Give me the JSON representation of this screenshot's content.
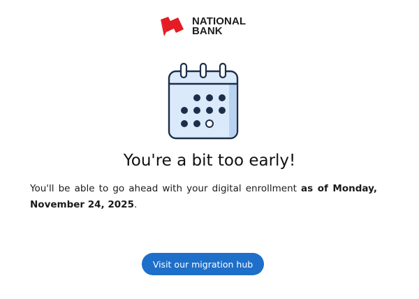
{
  "brand": {
    "name_line1": "NATIONAL",
    "name_line2": "BANK",
    "accent_color": "#e41c23",
    "logo_icon": "national-bank-flag-logo"
  },
  "illustration": {
    "icon": "calendar-icon",
    "line_color": "#1c2e4a",
    "fill_color": "#dbeafb"
  },
  "main": {
    "title": "You're a bit too early!",
    "message_prefix": "You'll be able to go ahead with your digital enrollment ",
    "message_bold": "as of Monday, November 24, 2025",
    "message_suffix": "."
  },
  "cta": {
    "label": "Visit our migration hub",
    "color": "#1e6fc9"
  }
}
